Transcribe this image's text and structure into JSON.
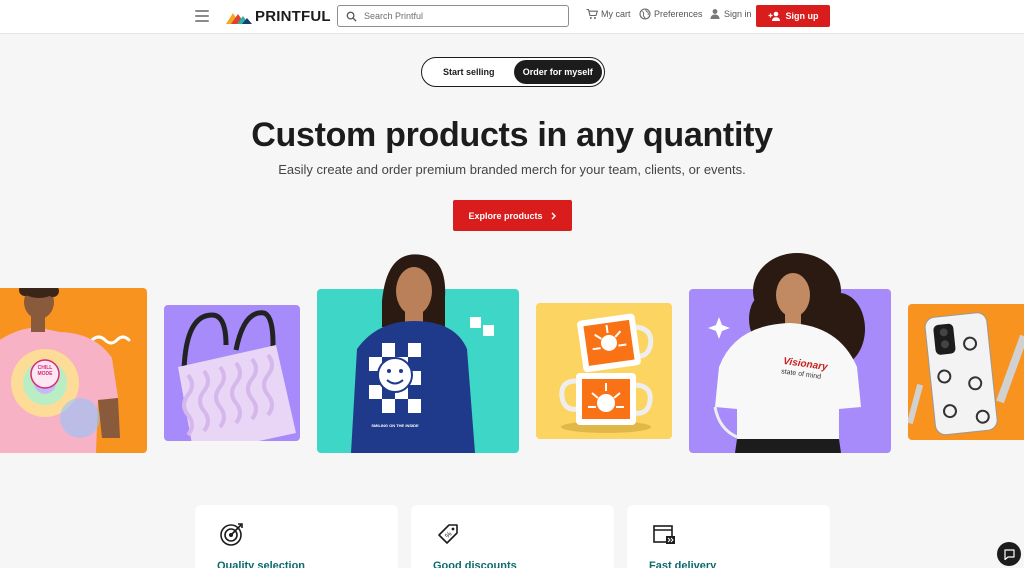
{
  "header": {
    "brand": "PRINTFUL",
    "search_placeholder": "Search Printful",
    "cart_label": "My cart",
    "preferences_label": "Preferences",
    "signin_label": "Sign in",
    "signup_label": "Sign up"
  },
  "toggle": {
    "option1": "Start selling",
    "option2": "Order for myself",
    "selected": "Order for myself"
  },
  "hero": {
    "title": "Custom products in any quantity",
    "subtitle": "Easily create and order premium branded merch for your team, clients, or events.",
    "cta_label": "Explore products"
  },
  "products": {
    "tee_print": "CHILL MODE",
    "sweatshirt_print": "SMILING ON THE INSIDE",
    "crewneck_print_line1": "Visionary",
    "crewneck_print_line2": "state of mind"
  },
  "features": [
    {
      "title": "Quality selection",
      "icon": "target-icon"
    },
    {
      "title": "Good discounts",
      "icon": "price-tag-icon"
    },
    {
      "title": "Fast delivery",
      "icon": "delivery-box-icon"
    }
  ],
  "colors": {
    "brand_red": "#d91c1c",
    "feature_title": "#0b6b6b",
    "tile_orange": "#f7931e",
    "tile_lavender": "#a78bfa",
    "tile_teal": "#3ed6c6",
    "tile_yellow": "#fcd462"
  }
}
